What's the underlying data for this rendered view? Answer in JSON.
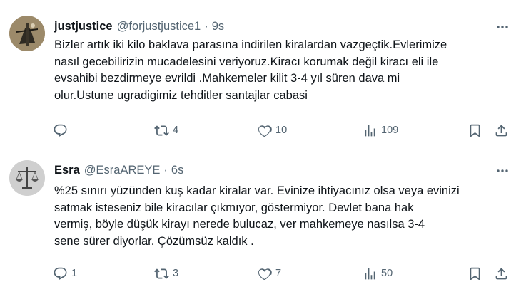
{
  "tweets": [
    {
      "name": "justjustice",
      "handle": "@forjustjustice1",
      "separator": "·",
      "time": "9s",
      "text": "Bizler artık iki kilo baklava parasına indirilen kiralardan vazgeçtik.Evlerimize\nnasıl gecebilirizin mucadelesini veriyoruz.Kiracı korumak değil kiracı eli ile\nevsahibi bezdirmeye evrildi .Mahkemeler kilit 3-4 yıl süren dava mi\nolur.Ustune ugradigimiz tehditler santajlar cabasi",
      "replies": "",
      "retweets": "4",
      "likes": "10",
      "views": "109"
    },
    {
      "name": "Esra",
      "handle": "@EsraAREYE",
      "separator": "·",
      "time": "6s",
      "text": "%25 sınırı yüzünden kuş kadar kiralar var. Evinize ihtiyacınız olsa veya evinizi\nsatmak isteseniz bile kiracılar çıkmıyor, göstermiyor. Devlet bana hak\nvermiş, böyle düşük kirayı nerede bulucaz, ver mahkemeye nasılsa 3-4\nsene sürer diyorlar. Çözümsüz kaldık .",
      "replies": "1",
      "retweets": "3",
      "likes": "7",
      "views": "50"
    }
  ],
  "colors": {
    "text": "#0f1419",
    "secondary": "#536471",
    "divider": "#eff3f4"
  },
  "icons": [
    "reply-icon",
    "retweet-icon",
    "like-icon",
    "views-icon",
    "bookmark-icon",
    "share-icon",
    "more-icon"
  ]
}
